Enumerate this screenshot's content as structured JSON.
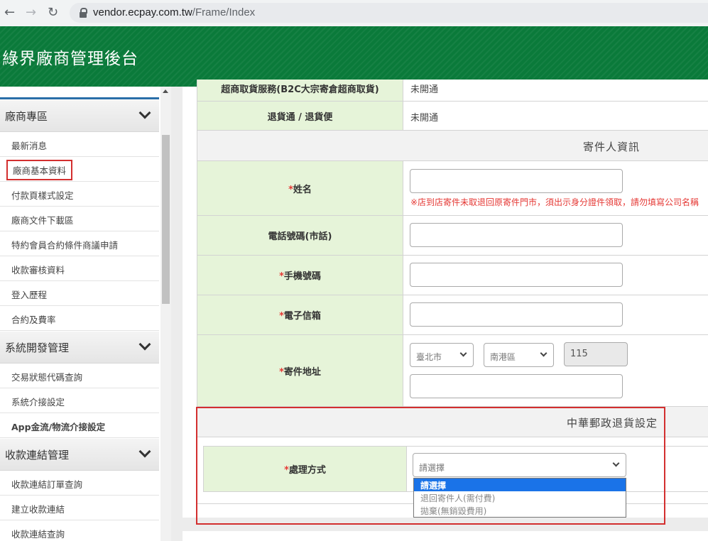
{
  "browser": {
    "url_host": "vendor.ecpay.com.tw",
    "url_path": "/Frame/Index"
  },
  "header": {
    "title": "綠界廠商管理後台"
  },
  "sidebar": {
    "sections": [
      {
        "label": "廠商專區",
        "items": [
          "最新消息",
          "廠商基本資料",
          "付款頁樣式設定",
          "廠商文件下載區",
          "特約會員合約條件商議申請",
          "收款審核資料",
          "登入歷程",
          "合約及費率"
        ]
      },
      {
        "label": "系統開發管理",
        "items": [
          "交易狀態代碼查詢",
          "系統介接設定",
          "App金流/物流介接設定"
        ]
      },
      {
        "label": "收款連結管理",
        "items": [
          "收款連結訂單查詢",
          "建立收款連結",
          "收款連結查詢"
        ]
      }
    ],
    "active_item": "廠商基本資料"
  },
  "form": {
    "row_cvs": {
      "label": "超商取貨服務(B2C大宗寄倉超商取貨)",
      "value": "未開通"
    },
    "row_return": {
      "label": "退貨通 / 退貨便",
      "value": "未開通"
    },
    "sender_section": "寄件人資訊",
    "name": {
      "required": "*",
      "label": "姓名",
      "value": "",
      "note": "※店到店寄件未取退回原寄件門市，須出示身分證件領取，請勿填寫公司名稱"
    },
    "tel": {
      "label": "電話號碼(市話)",
      "value": ""
    },
    "mobile": {
      "required": "*",
      "label": "手機號碼",
      "value": ""
    },
    "email": {
      "required": "*",
      "label": "電子信箱",
      "value": ""
    },
    "address": {
      "required": "*",
      "label": "寄件地址",
      "city": "臺北市",
      "district": "南港區",
      "zip": "115",
      "detail": ""
    },
    "post_section": "中華郵政退貨設定",
    "handling": {
      "required": "*",
      "label": "處理方式",
      "selected": "請選擇",
      "options": [
        "請選擇",
        "退回寄件人(需付費)",
        "拋棄(無銷毀費用)"
      ]
    }
  },
  "colors": {
    "header_green": "#0a7a3a",
    "label_bg": "#e6f4d9",
    "highlight_red": "#d32f2f",
    "option_blue": "#1a73e8"
  }
}
